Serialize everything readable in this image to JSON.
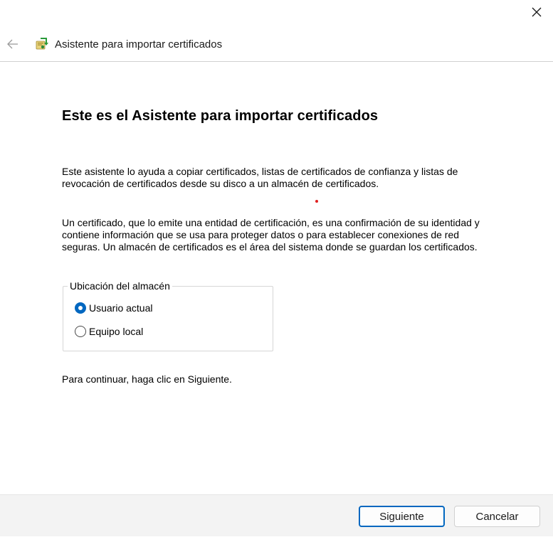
{
  "window": {
    "title": "Asistente para importar certificados",
    "close_icon": "close-icon",
    "back_icon": "arrow-left-icon",
    "app_icon": "certificate-import-icon"
  },
  "main": {
    "heading": "Este es el Asistente para importar certificados",
    "paragraph1": "Este asistente lo ayuda a copiar certificados, listas de certificados de confianza y listas de revocación de certificados desde su disco a un almacén de certificados.",
    "paragraph2": "Un certificado, que lo emite una entidad de certificación, es una confirmación de su identidad y contiene información que se usa para proteger datos o para establecer conexiones de red seguras. Un almacén de certificados es el área del sistema donde se guardan los certificados.",
    "store_location": {
      "legend": "Ubicación del almacén",
      "options": [
        {
          "label": "Usuario actual",
          "selected": true
        },
        {
          "label": "Equipo local",
          "selected": false
        }
      ]
    },
    "continue_text": "Para continuar, haga clic en Siguiente."
  },
  "footer": {
    "next_label": "Siguiente",
    "cancel_label": "Cancelar"
  },
  "colors": {
    "accent": "#0067c0",
    "footer_bg": "#f3f3f3",
    "marker": "#e02020"
  }
}
